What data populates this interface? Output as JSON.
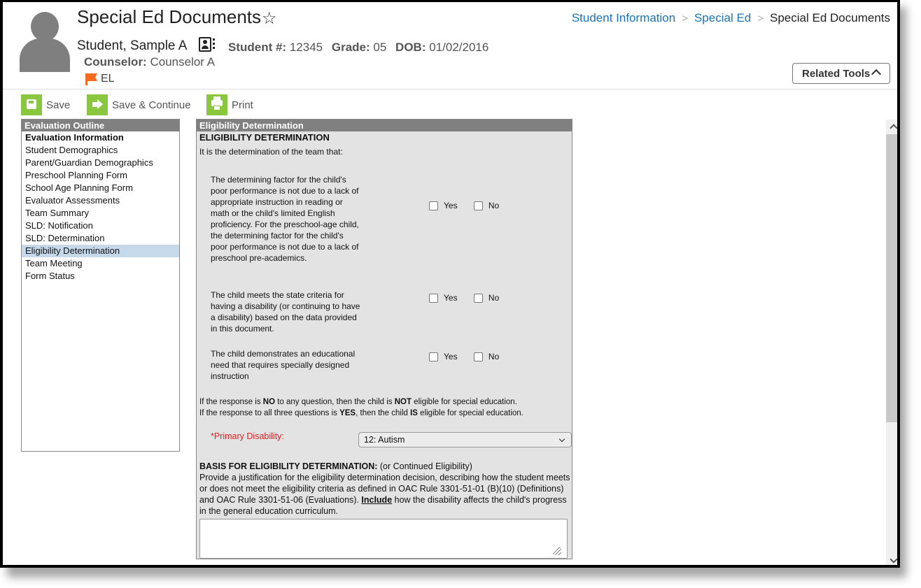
{
  "header": {
    "title": "Special Ed Documents",
    "student_name": "Student, Sample A",
    "student_number_label": "Student #:",
    "student_number": "12345",
    "grade_label": "Grade:",
    "grade": "05",
    "dob_label": "DOB:",
    "dob": "01/02/2016",
    "counselor_label": "Counselor:",
    "counselor": "Counselor A",
    "flag_label": "EL",
    "flag_color": "#f36a21"
  },
  "breadcrumb": [
    {
      "label": "Student Information"
    },
    {
      "label": "Special Ed"
    },
    {
      "label": "Special Ed Documents"
    }
  ],
  "related_tools_label": "Related Tools",
  "toolbar": {
    "save_label": "Save",
    "save_continue_label": "Save & Continue",
    "print_label": "Print",
    "accent_color": "#8bc63f"
  },
  "outline": {
    "title": "Evaluation Outline",
    "items": [
      {
        "label": "Evaluation Information"
      },
      {
        "label": "Student Demographics"
      },
      {
        "label": "Parent/Guardian Demographics"
      },
      {
        "label": "Preschool Planning Form"
      },
      {
        "label": "School Age Planning Form"
      },
      {
        "label": "Evaluator Assessments"
      },
      {
        "label": "Team Summary"
      },
      {
        "label": "SLD: Notification"
      },
      {
        "label": "SLD: Determination"
      },
      {
        "label": "Eligibility Determination"
      },
      {
        "label": "Team Meeting"
      },
      {
        "label": "Form Status"
      }
    ],
    "active_index": 9
  },
  "form": {
    "panel_title": "Eligibility Determination",
    "section_title": "ELIGIBILITY DETERMINATION",
    "intro": "It is the determination of the team that:",
    "yes_label": "Yes",
    "no_label": "No",
    "questions": [
      {
        "text": "The determining factor for the child's poor performance is not due to a lack of appropriate instruction in reading or math or the child's limited English proficiency. For the preschool-age child, the determining factor for the child's poor performance is not due to a lack of preschool pre-academics.",
        "yes": false,
        "no": false
      },
      {
        "text": "The child meets the state criteria for having a disability (or continuing to have a disability) based on the data provided in this document.",
        "yes": false,
        "no": false
      },
      {
        "text": "The child demonstrates an educational need that requires specially designed instruction",
        "yes": false,
        "no": false
      }
    ],
    "rule1": {
      "a": "If the response is ",
      "b": "NO",
      "c": " to any question, then the child is ",
      "d": "NOT",
      "e": " eligible for special education."
    },
    "rule2": {
      "a": "If the response to all three questions is ",
      "b": "YES",
      "c": ", then the child ",
      "d": "IS",
      "e": " eligible for special education."
    },
    "primary_disability_label": "*Primary Disability:",
    "primary_disability_value": "12: Autism",
    "basis_title": "BASIS FOR ELIGIBILITY DETERMINATION:",
    "basis_subtitle": " (or Continued Eligibility)",
    "basis_text_a": "Provide a justification for the eligibility determination decision, describing how the student meets or does not meet the eligibility criteria as defined in OAC Rule 3301-51-01 (B)(10) (Definitions) and OAC Rule 3301-51-06 (Evaluations). ",
    "basis_text_include": "Include",
    "basis_text_b": " how the disability affects the child's progress in the general education curriculum.",
    "justification_value": ""
  }
}
